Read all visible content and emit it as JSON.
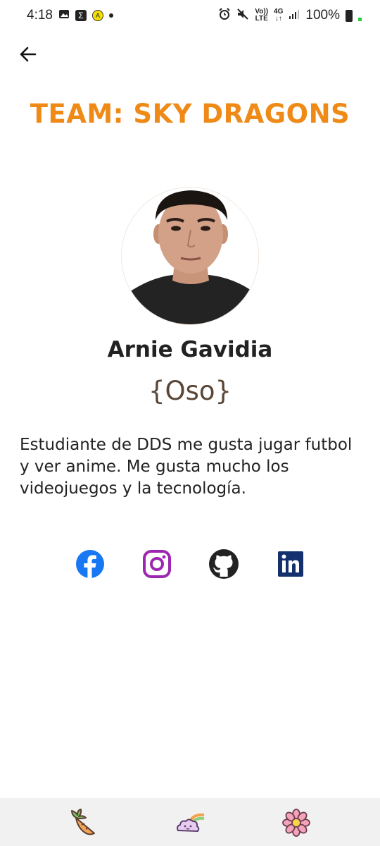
{
  "status_bar": {
    "time": "4:18",
    "battery": "100%",
    "network": "4G",
    "volte_top": "Vo))",
    "volte_bottom": "LTE"
  },
  "header": {
    "team_title": "TEAM: SKY DRAGONS"
  },
  "profile": {
    "name": "Arnie Gavidia",
    "nickname": "{Oso}",
    "bio": "Estudiante de DDS me gusta jugar futbol y ver anime. Me gusta mucho los videojuegos y la tecnología."
  },
  "social": [
    {
      "icon": "facebook-icon",
      "color": "#1877f2"
    },
    {
      "icon": "instagram-icon",
      "color": "#9c27b0"
    },
    {
      "icon": "github-icon",
      "color": "#222222"
    },
    {
      "icon": "linkedin-icon",
      "color": "#14306e"
    }
  ],
  "bottom_nav": [
    {
      "icon": "carrot-icon"
    },
    {
      "icon": "cloud-rainbow-icon"
    },
    {
      "icon": "flower-icon"
    }
  ],
  "colors": {
    "accent": "#ef8a17",
    "nickname": "#5a4636",
    "nav_background": "#f1f1f1"
  }
}
